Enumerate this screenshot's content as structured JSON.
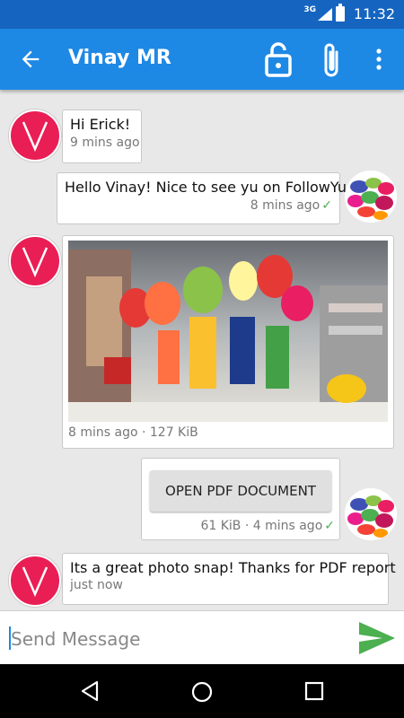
{
  "status": {
    "network": "3G",
    "time": "11:32"
  },
  "header": {
    "back_icon": "arrow-back-icon",
    "title": "Vinay MR",
    "lock_icon": "unlock-icon",
    "attach_icon": "paperclip-icon",
    "menu_icon": "more-vertical-icon"
  },
  "messages": [
    {
      "from": "other",
      "text": "Hi Erick!",
      "meta": "9 mins ago"
    },
    {
      "from": "self",
      "text": "Hello Vinay! Nice to see yu on FollowYu",
      "meta": "8 mins ago"
    },
    {
      "from": "other",
      "type": "image",
      "meta": "8 mins ago · 127 KiB"
    },
    {
      "from": "self",
      "type": "file",
      "button_label": "OPEN PDF DOCUMENT",
      "meta": "61 KiB · 4 mins ago"
    },
    {
      "from": "other",
      "text": "Its a great photo snap! Thanks for PDF report",
      "meta": "just now"
    }
  ],
  "composer": {
    "placeholder": "Send Message",
    "send_icon": "send-icon"
  },
  "nav": {
    "back_icon": "nav-back-icon",
    "home_icon": "nav-home-icon",
    "recent_icon": "nav-recent-icon"
  },
  "colors": {
    "primary": "#1e88e5",
    "status_bar": "#1565c0",
    "avatar": "#e91e55",
    "send": "#4caf50",
    "read_check": "#4caf50"
  }
}
